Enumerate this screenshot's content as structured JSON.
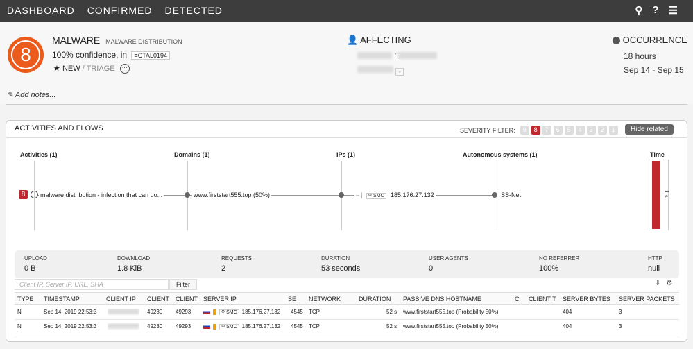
{
  "nav": {
    "items": [
      "DASHBOARD",
      "CONFIRMED",
      "DETECTED"
    ],
    "icons": [
      "search-icon",
      "help-icon",
      "menu-icon"
    ]
  },
  "alert": {
    "severity": "8",
    "type": "MALWARE",
    "subtype": "MALWARE DISTRIBUTION",
    "confidence": "100% confidence, in",
    "tag": "CTAL0194",
    "status_new": "NEW",
    "status_sep": " / ",
    "status_triage": "TRIAGE"
  },
  "affecting": {
    "title": "AFFECTING"
  },
  "occurrence": {
    "title": "OCCURRENCE",
    "duration": "18 hours",
    "range": "Sep 14 - Sep 15"
  },
  "notes": {
    "label": "Add notes..."
  },
  "panel": {
    "title": "ACTIVITIES AND FLOWS",
    "severity_filter_label": "SEVERITY FILTER:",
    "severity_levels": [
      "9",
      "8",
      "7",
      "6",
      "5",
      "4",
      "3",
      "2",
      "1"
    ],
    "active_severity": "8",
    "hide_related": "Hide related",
    "columns": {
      "activities": "Activities (1)",
      "domains": "Domains (1)",
      "ips": "IPs (1)",
      "asys": "Autonomous systems (1)",
      "time": "Time"
    },
    "flow": {
      "badge": "8",
      "activity": "malware distribution - infection that can do...",
      "domain": "www.firststart555.top (50%)",
      "ip_prefix": "– | ",
      "smc": "SMC",
      "ip": "185.176.27.132",
      "asys": "SS-Net",
      "time_label": "1 s"
    }
  },
  "stats": [
    {
      "k": "UPLOAD",
      "v": "0 B"
    },
    {
      "k": "DOWNLOAD",
      "v": "1.8 KiB"
    },
    {
      "k": "REQUESTS",
      "v": "2"
    },
    {
      "k": "DURATION",
      "v": "53 seconds"
    },
    {
      "k": "USER AGENTS",
      "v": "0"
    },
    {
      "k": "NO REFERRER",
      "v": "100%"
    },
    {
      "k": "HTTP",
      "v": "null"
    }
  ],
  "filter": {
    "placeholder": "Client IP, Server IP, URL, SHA",
    "button": "Filter"
  },
  "table": {
    "headers": [
      "TYPE",
      "TIMESTAMP",
      "CLIENT IP",
      "CLIENT",
      "CLIENT",
      "SERVER IP",
      "SE",
      "NETWORK",
      "DURATION",
      "PASSIVE DNS HOSTNAME",
      "C",
      "CLIENT T",
      "SERVER BYTES",
      "SERVER PACKETS"
    ],
    "rows": [
      {
        "type": "N",
        "timestamp": "Sep 14, 2019 22:53:3",
        "c1": "49230",
        "c2": "49293",
        "smc": "SMC",
        "server_ip": "185.176.27.132",
        "se": "4545",
        "network": "TCP",
        "duration": "52 s",
        "hostname": "www.firststart555.top (Probability 50%)",
        "server_bytes": "404",
        "server_packets": "3"
      },
      {
        "type": "N",
        "timestamp": "Sep 14, 2019 22:53:3",
        "c1": "49230",
        "c2": "49293",
        "smc": "SMC",
        "server_ip": "185.176.27.132",
        "se": "4545",
        "network": "TCP",
        "duration": "52 s",
        "hostname": "www.firststart555.top (Probability 50%)",
        "server_bytes": "404",
        "server_packets": "3"
      }
    ]
  }
}
